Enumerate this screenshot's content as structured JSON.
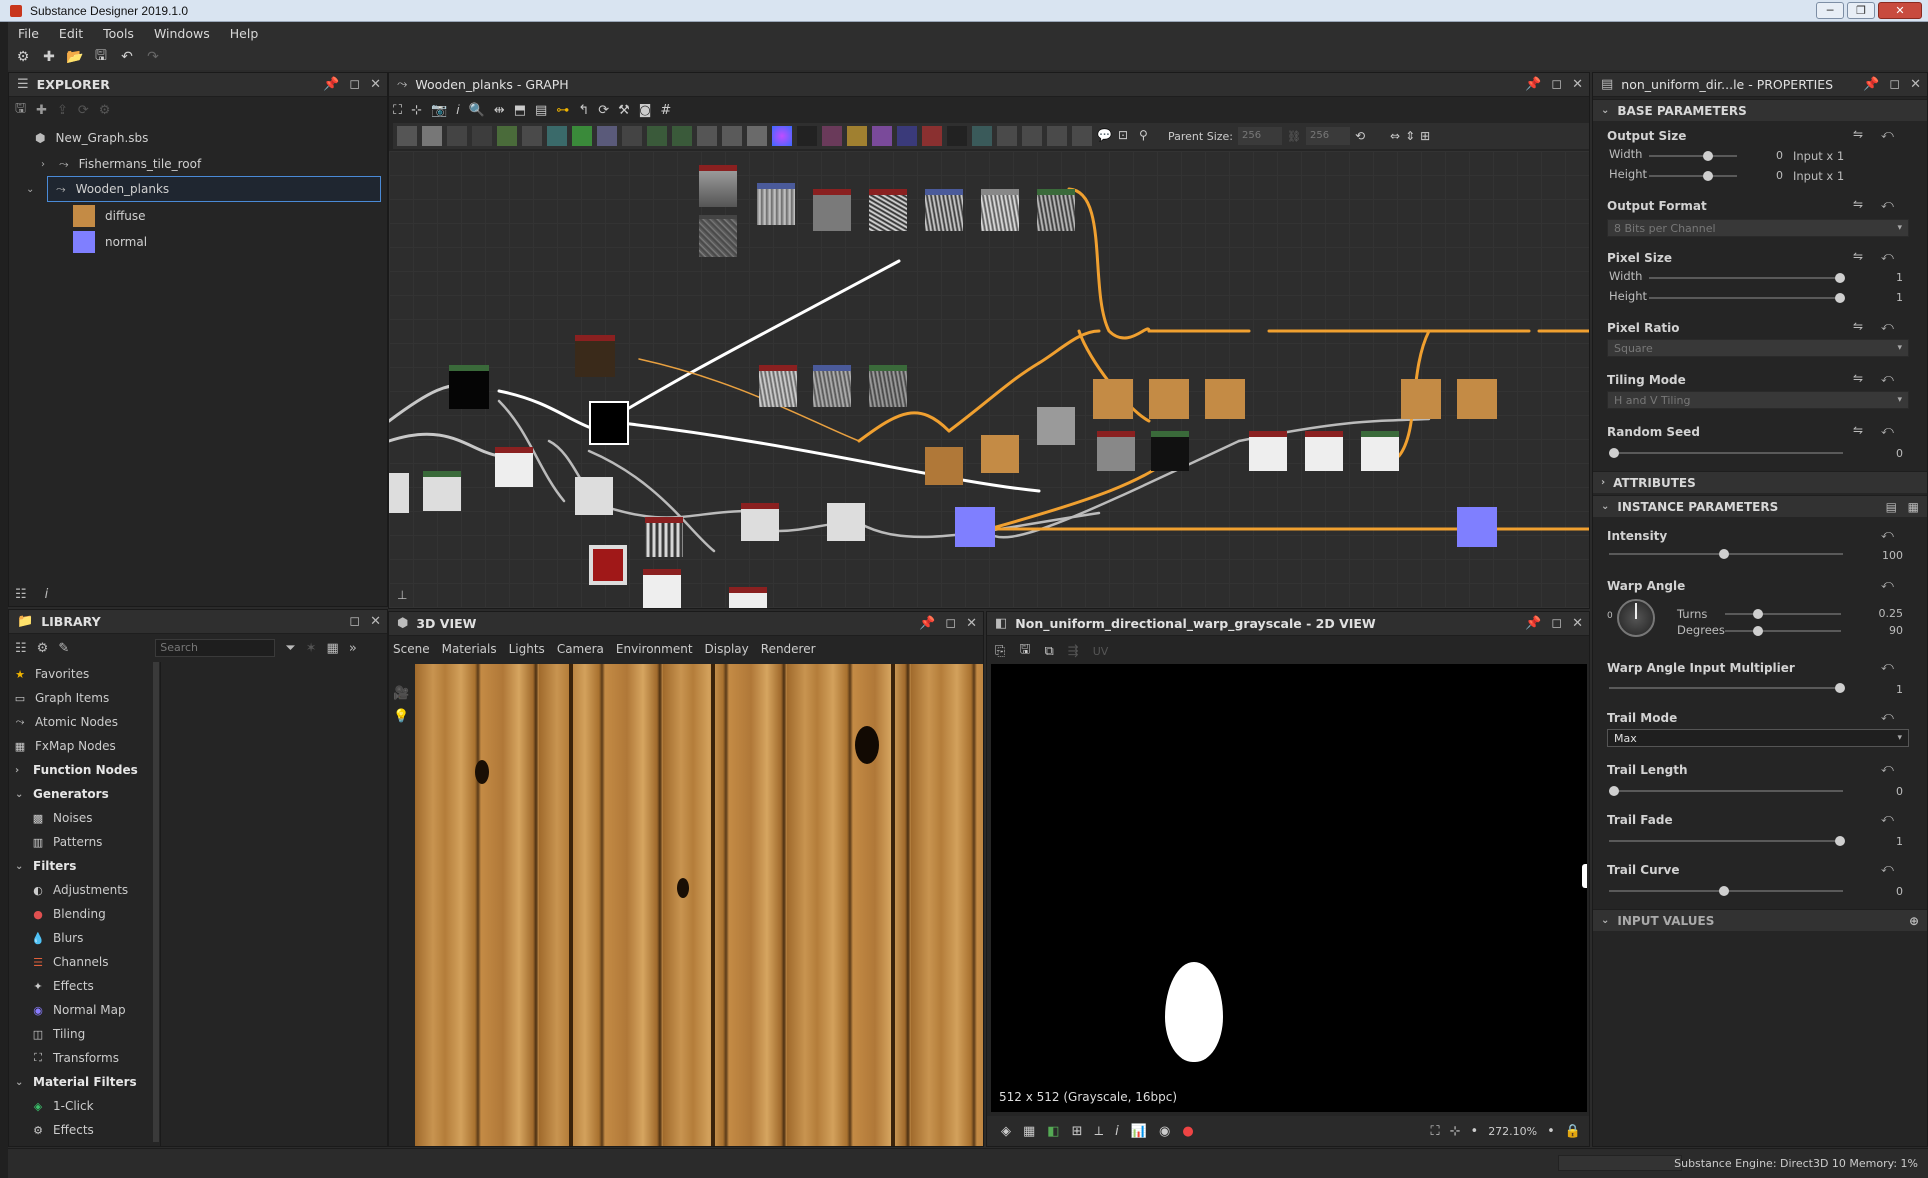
{
  "window": {
    "title": "Substance Designer 2019.1.0"
  },
  "menu": [
    "File",
    "Edit",
    "Tools",
    "Windows",
    "Help"
  ],
  "explorer": {
    "title": "EXPLORER",
    "items": [
      {
        "label": "New_Graph.sbs"
      },
      {
        "label": "Fishermans_tile_roof"
      },
      {
        "label": "Wooden_planks"
      },
      {
        "label": "diffuse"
      },
      {
        "label": "normal"
      }
    ],
    "swatch_colors": {
      "diffuse": "#c48b45",
      "normal": "#7f7fff"
    }
  },
  "graph": {
    "title": "Wooden_planks - GRAPH",
    "parent_size_label": "Parent Size:",
    "parent_w": "256",
    "parent_h": "256"
  },
  "library": {
    "title": "LIBRARY",
    "search_placeholder": "Search",
    "items": [
      {
        "label": "Favorites"
      },
      {
        "label": "Graph Items"
      },
      {
        "label": "Atomic Nodes"
      },
      {
        "label": "FxMap Nodes"
      },
      {
        "label": "Function Nodes"
      },
      {
        "label": "Generators"
      },
      {
        "label": "Noises"
      },
      {
        "label": "Patterns"
      },
      {
        "label": "Filters"
      },
      {
        "label": "Adjustments"
      },
      {
        "label": "Blending"
      },
      {
        "label": "Blurs"
      },
      {
        "label": "Channels"
      },
      {
        "label": "Effects"
      },
      {
        "label": "Normal Map"
      },
      {
        "label": "Tiling"
      },
      {
        "label": "Transforms"
      },
      {
        "label": "Material Filters"
      },
      {
        "label": "1-Click"
      },
      {
        "label": "Effects"
      }
    ]
  },
  "view3d": {
    "title": "3D VIEW",
    "menu": [
      "Scene",
      "Materials",
      "Lights",
      "Camera",
      "Environment",
      "Display",
      "Renderer"
    ]
  },
  "view2d": {
    "title": "Non_uniform_directional_warp_grayscale - 2D VIEW",
    "info": "512 x 512 (Grayscale, 16bpc)",
    "zoom": "272.10%",
    "uv_label": "UV"
  },
  "properties": {
    "title": "non_uniform_dir...le - PROPERTIES",
    "base_parameters": "BASE PARAMETERS",
    "output_size": {
      "label": "Output Size",
      "width_label": "Width",
      "height_label": "Height",
      "width_val": "0",
      "height_val": "0",
      "width_mode": "Input x 1",
      "height_mode": "Input x 1"
    },
    "output_format": {
      "label": "Output Format",
      "value": "8 Bits per Channel"
    },
    "pixel_size": {
      "label": "Pixel Size",
      "width_label": "Width",
      "height_label": "Height",
      "width_val": "1",
      "height_val": "1"
    },
    "pixel_ratio": {
      "label": "Pixel Ratio",
      "value": "Square"
    },
    "tiling_mode": {
      "label": "Tiling Mode",
      "value": "H and V Tiling"
    },
    "random_seed": {
      "label": "Random Seed",
      "value": "0"
    },
    "attributes": "ATTRIBUTES",
    "instance_parameters": "INSTANCE PARAMETERS",
    "intensity": {
      "label": "Intensity",
      "value": "100"
    },
    "warp_angle": {
      "label": "Warp Angle",
      "turns_label": "Turns",
      "degrees_label": "Degrees",
      "turns": "0.25",
      "degrees": "90",
      "dial_zero": "0"
    },
    "warp_angle_mult": {
      "label": "Warp Angle Input Multiplier",
      "value": "1"
    },
    "trail_mode": {
      "label": "Trail Mode",
      "value": "Max"
    },
    "trail_length": {
      "label": "Trail Length",
      "value": "0"
    },
    "trail_fade": {
      "label": "Trail Fade",
      "value": "1"
    },
    "trail_curve": {
      "label": "Trail Curve",
      "value": "0"
    },
    "input_values": "INPUT VALUES"
  },
  "status": {
    "engine": "Substance Engine: Direct3D 10  Memory: 1%"
  }
}
